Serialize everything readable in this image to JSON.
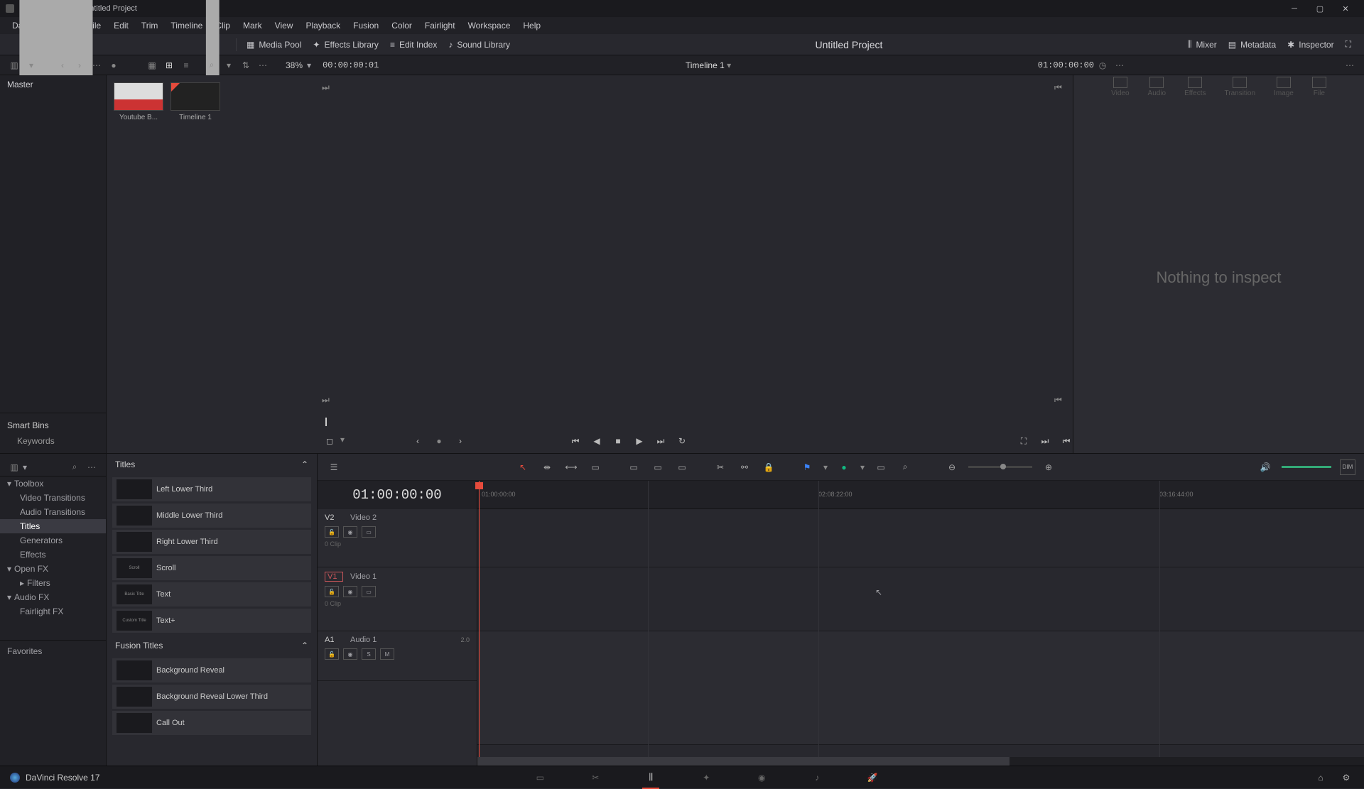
{
  "titlebar": {
    "text": "DaVinci Resolve - Untitled Project"
  },
  "menu": [
    "DaVinci Resolve",
    "File",
    "Edit",
    "Trim",
    "Timeline",
    "Clip",
    "Mark",
    "View",
    "Playback",
    "Fusion",
    "Color",
    "Fairlight",
    "Workspace",
    "Help"
  ],
  "toolbar": {
    "media_pool": "Media Pool",
    "effects_library": "Effects Library",
    "edit_index": "Edit Index",
    "sound_library": "Sound Library",
    "project": "Untitled Project",
    "mixer": "Mixer",
    "metadata": "Metadata",
    "inspector": "Inspector"
  },
  "subbar": {
    "zoom_pct": "38%",
    "tc_left": "00:00:00:01",
    "timeline_name": "Timeline 1",
    "tc_right": "01:00:00:00"
  },
  "bins": {
    "master": "Master",
    "smart": "Smart Bins",
    "keywords": "Keywords"
  },
  "media": [
    {
      "label": "Youtube B..."
    },
    {
      "label": "Timeline 1"
    }
  ],
  "inspector": {
    "tabs": [
      "Video",
      "Audio",
      "Effects",
      "Transition",
      "Image",
      "File"
    ],
    "empty": "Nothing to inspect"
  },
  "fxtree": {
    "toolbox": "Toolbox",
    "video_tr": "Video Transitions",
    "audio_tr": "Audio Transitions",
    "titles": "Titles",
    "generators": "Generators",
    "effects": "Effects",
    "openfx": "Open FX",
    "filters": "Filters",
    "audiofx": "Audio FX",
    "fairlight": "Fairlight FX",
    "favorites": "Favorites"
  },
  "titles_panel": {
    "header1": "Titles",
    "items1": [
      {
        "thumb": "",
        "label": "Left Lower Third"
      },
      {
        "thumb": "",
        "label": "Middle Lower Third"
      },
      {
        "thumb": "",
        "label": "Right Lower Third"
      },
      {
        "thumb": "Scroll",
        "label": "Scroll"
      },
      {
        "thumb": "Basic Title",
        "label": "Text"
      },
      {
        "thumb": "Custom Title",
        "label": "Text+"
      }
    ],
    "header2": "Fusion Titles",
    "items2": [
      {
        "thumb": "",
        "label": "Background Reveal"
      },
      {
        "thumb": "",
        "label": "Background Reveal Lower Third"
      },
      {
        "thumb": "",
        "label": "Call Out"
      }
    ]
  },
  "timeline": {
    "tc": "01:00:00:00",
    "ruler": [
      "01:00:00:00",
      "02:08:22:00",
      "03:16:44:00"
    ],
    "tracks": [
      {
        "id": "V2",
        "name": "Video 2",
        "clips": "0 Clip"
      },
      {
        "id": "V1",
        "name": "Video 1",
        "clips": "0 Clip",
        "selected": true
      },
      {
        "id": "A1",
        "name": "Audio 1",
        "level": "2.0"
      }
    ]
  },
  "bottom": {
    "version": "DaVinci Resolve 17"
  }
}
